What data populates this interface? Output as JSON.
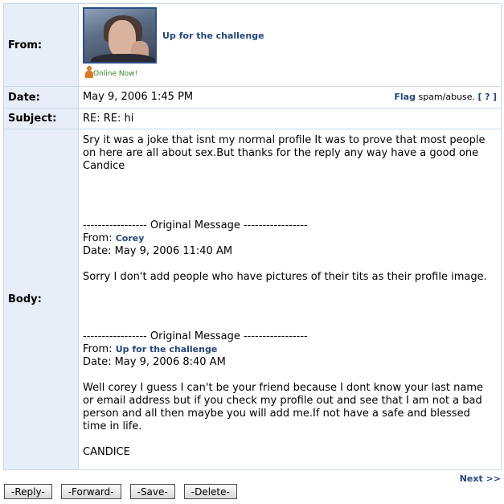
{
  "labels": {
    "from": "From:",
    "date": "Date:",
    "subject": "Subject:",
    "body": "Body:"
  },
  "from": {
    "name": "Up for the challenge",
    "status": "Online Now!"
  },
  "date": {
    "value": "May 9, 2006 1:45 PM",
    "flag_link": "Flag",
    "flag_text": "spam/abuse.",
    "help_open": "[",
    "help_link": "?",
    "help_close": "]"
  },
  "subject": "RE: RE: hi",
  "body": {
    "reply": "Sry it was a joke that isnt my normal profile It was to prove that most people on here are all about sex.But thanks for the reply any way have a good one Candice",
    "quote1": {
      "separator": "----------------- Original Message -----------------",
      "from_label": "From:",
      "from_name": "Corey",
      "date_line": "Date: May 9, 2006 11:40 AM",
      "text": "Sorry I don't add people who have pictures of their tits as their profile image."
    },
    "quote2": {
      "separator": "----------------- Original Message -----------------",
      "from_label": "From:",
      "from_name": "Up for the challenge",
      "date_line": "Date: May 9, 2006 8:40 AM",
      "text": "Well corey I guess I can't be your friend because I dont know your last name or email address but if you check my profile out and see that I am not a bad person and all then maybe you will add me.If not have a safe and blessed time in life.",
      "signature": "CANDICE"
    }
  },
  "nav": {
    "next": "Next >>"
  },
  "buttons": {
    "reply": "-Reply-",
    "forward": "-Forward-",
    "save": "-Save-",
    "delete": "-Delete-"
  },
  "colors": {
    "link": "#23467f",
    "label_bg": "#e7eef7",
    "border": "#c9d7e8",
    "online": "#2a8a1f"
  }
}
